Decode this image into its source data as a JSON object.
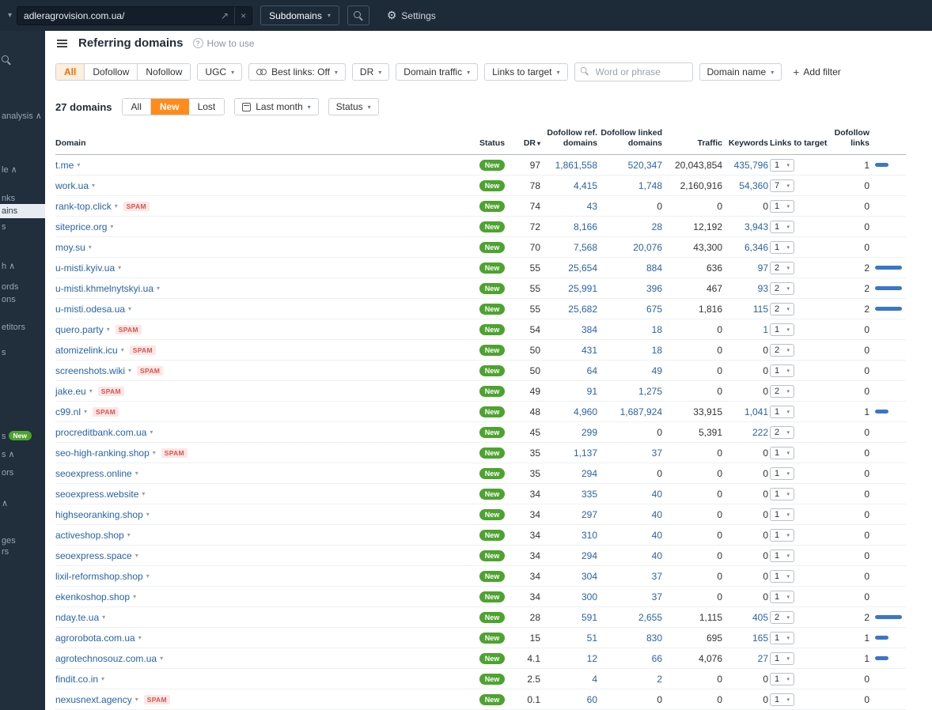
{
  "colors": {
    "accent_orange": "#ff8c1a",
    "link_blue": "#2a63a5",
    "new_green": "#4da32f",
    "spam_red": "#d9534f",
    "bar_blue": "#3b76c9",
    "topbar_bg": "#1d2a37"
  },
  "topbar": {
    "url": "adleragrovision.com.ua/",
    "subdomains_label": "Subdomains",
    "settings_label": "Settings"
  },
  "sidebar": {
    "new_badge": "New",
    "fragments": [
      {
        "label": "analysis ∧"
      },
      {
        "label": "le ∧"
      },
      {
        "label": "nks"
      },
      {
        "label": "ains"
      },
      {
        "label": "s"
      },
      {
        "label": "h ∧"
      },
      {
        "label": "ords"
      },
      {
        "label": "ons"
      },
      {
        "label": "etitors"
      },
      {
        "label": "s"
      },
      {
        "label": "s"
      },
      {
        "label": "s ∧"
      },
      {
        "label": "ors"
      },
      {
        "label": "∧"
      },
      {
        "label": "ges"
      },
      {
        "label": "rs"
      }
    ]
  },
  "header": {
    "title": "Referring domains",
    "help": "How to use"
  },
  "filters": {
    "group": [
      "All",
      "Dofollow",
      "Nofollow"
    ],
    "selected": "All",
    "ugc": "UGC",
    "best_links": "Best links: Off",
    "dr": "DR",
    "domain_traffic": "Domain traffic",
    "links_to_target": "Links to target",
    "search_placeholder": "Word or phrase",
    "domain_name": "Domain name",
    "add_filter": "Add filter"
  },
  "toolbar": {
    "count": "27 domains",
    "seg_all": "All",
    "seg_new": "New",
    "seg_lost": "Lost",
    "period": "Last month",
    "status": "Status"
  },
  "table": {
    "headers": {
      "domain": "Domain",
      "status": "Status",
      "dr": "DR",
      "dofollow_ref": "Dofollow ref. domains",
      "dofollow_linked": "Dofollow linked domains",
      "traffic": "Traffic",
      "keywords": "Keywords",
      "links_to_target": "Links to target",
      "dofollow_links": "Dofollow links"
    },
    "spam_label": "SPAM",
    "rows": [
      {
        "domain": "t.me",
        "spam": false,
        "status": "New",
        "dr": "97",
        "ref": "1,861,558",
        "linked": "520,347",
        "traffic": "20,043,854",
        "keywords": "435,796",
        "links_select": "1",
        "dofollow_links": 1
      },
      {
        "domain": "work.ua",
        "spam": false,
        "status": "New",
        "dr": "78",
        "ref": "4,415",
        "linked": "1,748",
        "traffic": "2,160,916",
        "keywords": "54,360",
        "links_select": "7",
        "dofollow_links": 0
      },
      {
        "domain": "rank-top.click",
        "spam": true,
        "status": "New",
        "dr": "74",
        "ref": "43",
        "linked": "0",
        "traffic": "0",
        "keywords": "0",
        "links_select": "1",
        "dofollow_links": 0
      },
      {
        "domain": "siteprice.org",
        "spam": false,
        "status": "New",
        "dr": "72",
        "ref": "8,166",
        "linked": "28",
        "traffic": "12,192",
        "keywords": "3,943",
        "links_select": "1",
        "dofollow_links": 0
      },
      {
        "domain": "moy.su",
        "spam": false,
        "status": "New",
        "dr": "70",
        "ref": "7,568",
        "linked": "20,076",
        "traffic": "43,300",
        "keywords": "6,346",
        "links_select": "1",
        "dofollow_links": 0
      },
      {
        "domain": "u-misti.kyiv.ua",
        "spam": false,
        "status": "New",
        "dr": "55",
        "ref": "25,654",
        "linked": "884",
        "traffic": "636",
        "keywords": "97",
        "links_select": "2",
        "dofollow_links": 2
      },
      {
        "domain": "u-misti.khmelnytskyi.ua",
        "spam": false,
        "status": "New",
        "dr": "55",
        "ref": "25,991",
        "linked": "396",
        "traffic": "467",
        "keywords": "93",
        "links_select": "2",
        "dofollow_links": 2
      },
      {
        "domain": "u-misti.odesa.ua",
        "spam": false,
        "status": "New",
        "dr": "55",
        "ref": "25,682",
        "linked": "675",
        "traffic": "1,816",
        "keywords": "115",
        "links_select": "2",
        "dofollow_links": 2
      },
      {
        "domain": "quero.party",
        "spam": true,
        "status": "New",
        "dr": "54",
        "ref": "384",
        "linked": "18",
        "traffic": "0",
        "keywords": "1",
        "links_select": "1",
        "dofollow_links": 0
      },
      {
        "domain": "atomizelink.icu",
        "spam": true,
        "status": "New",
        "dr": "50",
        "ref": "431",
        "linked": "18",
        "traffic": "0",
        "keywords": "0",
        "links_select": "2",
        "dofollow_links": 0
      },
      {
        "domain": "screenshots.wiki",
        "spam": true,
        "status": "New",
        "dr": "50",
        "ref": "64",
        "linked": "49",
        "traffic": "0",
        "keywords": "0",
        "links_select": "1",
        "dofollow_links": 0
      },
      {
        "domain": "jake.eu",
        "spam": true,
        "status": "New",
        "dr": "49",
        "ref": "91",
        "linked": "1,275",
        "traffic": "0",
        "keywords": "0",
        "links_select": "2",
        "dofollow_links": 0
      },
      {
        "domain": "c99.nl",
        "spam": true,
        "status": "New",
        "dr": "48",
        "ref": "4,960",
        "linked": "1,687,924",
        "traffic": "33,915",
        "keywords": "1,041",
        "links_select": "1",
        "dofollow_links": 1
      },
      {
        "domain": "procreditbank.com.ua",
        "spam": false,
        "status": "New",
        "dr": "45",
        "ref": "299",
        "linked": "0",
        "traffic": "5,391",
        "keywords": "222",
        "links_select": "2",
        "dofollow_links": 0
      },
      {
        "domain": "seo-high-ranking.shop",
        "spam": true,
        "status": "New",
        "dr": "35",
        "ref": "1,137",
        "linked": "37",
        "traffic": "0",
        "keywords": "0",
        "links_select": "1",
        "dofollow_links": 0
      },
      {
        "domain": "seoexpress.online",
        "spam": false,
        "status": "New",
        "dr": "35",
        "ref": "294",
        "linked": "0",
        "traffic": "0",
        "keywords": "0",
        "links_select": "1",
        "dofollow_links": 0
      },
      {
        "domain": "seoexpress.website",
        "spam": false,
        "status": "New",
        "dr": "34",
        "ref": "335",
        "linked": "40",
        "traffic": "0",
        "keywords": "0",
        "links_select": "1",
        "dofollow_links": 0
      },
      {
        "domain": "highseoranking.shop",
        "spam": false,
        "status": "New",
        "dr": "34",
        "ref": "297",
        "linked": "40",
        "traffic": "0",
        "keywords": "0",
        "links_select": "1",
        "dofollow_links": 0
      },
      {
        "domain": "activeshop.shop",
        "spam": false,
        "status": "New",
        "dr": "34",
        "ref": "310",
        "linked": "40",
        "traffic": "0",
        "keywords": "0",
        "links_select": "1",
        "dofollow_links": 0
      },
      {
        "domain": "seoexpress.space",
        "spam": false,
        "status": "New",
        "dr": "34",
        "ref": "294",
        "linked": "40",
        "traffic": "0",
        "keywords": "0",
        "links_select": "1",
        "dofollow_links": 0
      },
      {
        "domain": "lixil-reformshop.shop",
        "spam": false,
        "status": "New",
        "dr": "34",
        "ref": "304",
        "linked": "37",
        "traffic": "0",
        "keywords": "0",
        "links_select": "1",
        "dofollow_links": 0
      },
      {
        "domain": "ekenkoshop.shop",
        "spam": false,
        "status": "New",
        "dr": "34",
        "ref": "300",
        "linked": "37",
        "traffic": "0",
        "keywords": "0",
        "links_select": "1",
        "dofollow_links": 0
      },
      {
        "domain": "nday.te.ua",
        "spam": false,
        "status": "New",
        "dr": "28",
        "ref": "591",
        "linked": "2,655",
        "traffic": "1,115",
        "keywords": "405",
        "links_select": "2",
        "dofollow_links": 2
      },
      {
        "domain": "agrorobota.com.ua",
        "spam": false,
        "status": "New",
        "dr": "15",
        "ref": "51",
        "linked": "830",
        "traffic": "695",
        "keywords": "165",
        "links_select": "1",
        "dofollow_links": 1
      },
      {
        "domain": "agrotechnosouz.com.ua",
        "spam": false,
        "status": "New",
        "dr": "4.1",
        "ref": "12",
        "linked": "66",
        "traffic": "4,076",
        "keywords": "27",
        "links_select": "1",
        "dofollow_links": 1
      },
      {
        "domain": "findit.co.in",
        "spam": false,
        "status": "New",
        "dr": "2.5",
        "ref": "4",
        "linked": "2",
        "traffic": "0",
        "keywords": "0",
        "links_select": "1",
        "dofollow_links": 0
      },
      {
        "domain": "nexusnext.agency",
        "spam": true,
        "status": "New",
        "dr": "0.1",
        "ref": "60",
        "linked": "0",
        "traffic": "0",
        "keywords": "0",
        "links_select": "1",
        "dofollow_links": 0
      }
    ]
  }
}
